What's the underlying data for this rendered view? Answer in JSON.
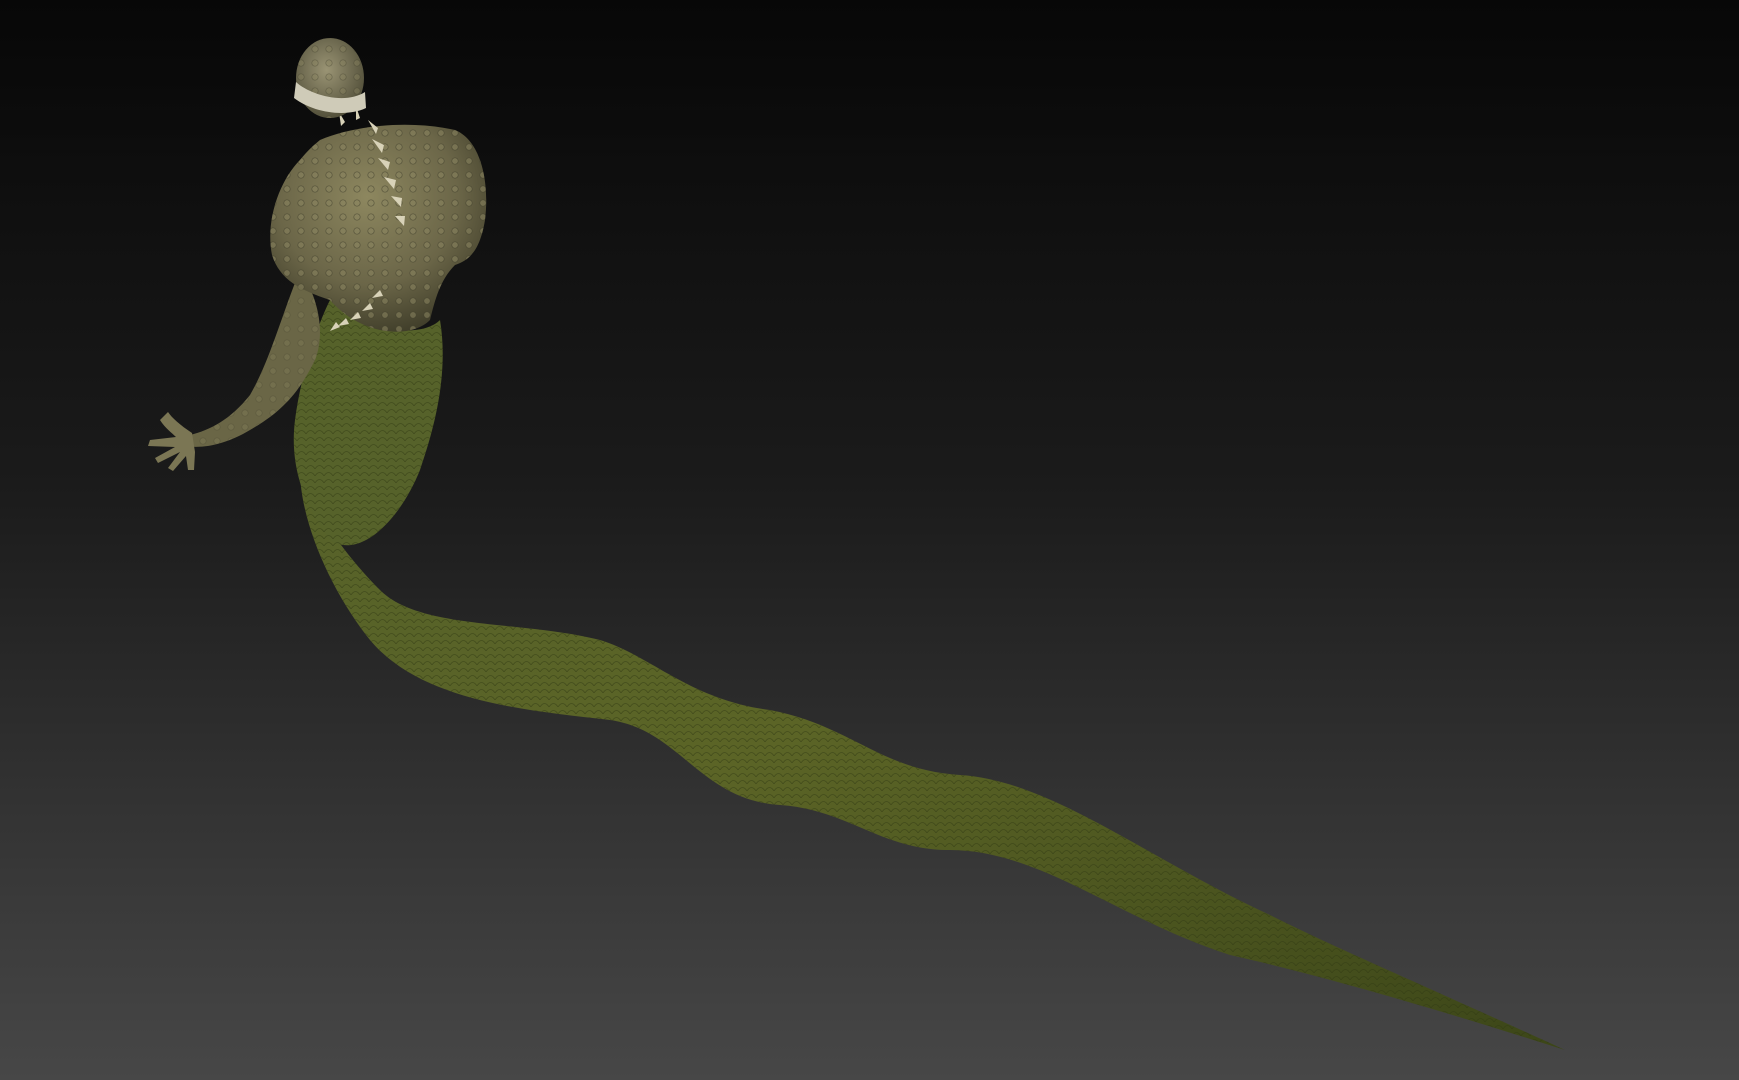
{
  "scene": {
    "subject_icon": "naga-serpent-creature-icon",
    "colors": {
      "background_top": "#070707",
      "background_mid": "#1b1b1b",
      "background_bottom": "#474747",
      "skin_torso": "#6b6648",
      "skin_torso_light": "#8d875f",
      "skin_torso_dark": "#3c3a27",
      "tail_green": "#4e5a22",
      "tail_green_light": "#7b7f35",
      "tail_green_dark": "#2c3412",
      "spike": "#d8d2b8",
      "blindfold": "#cfcbb8"
    }
  }
}
